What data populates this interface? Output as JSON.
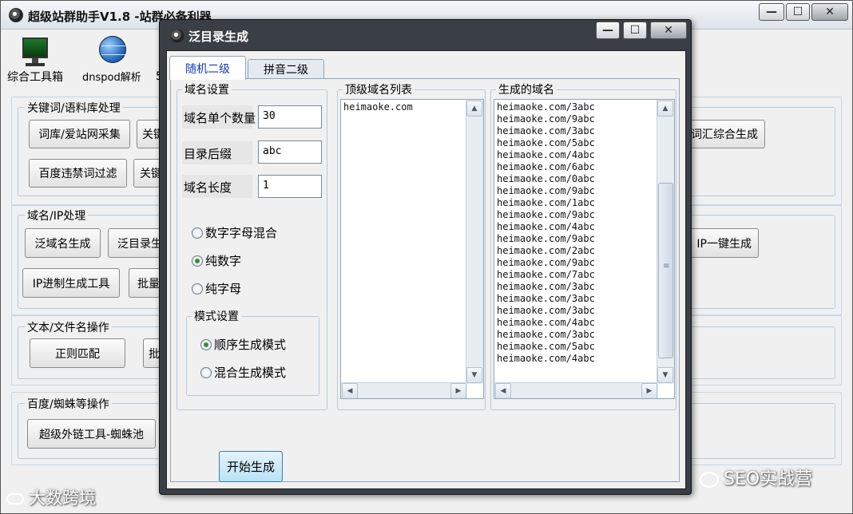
{
  "main_window": {
    "title": "超级站群助手V1.8 -站群必备利器",
    "toolbar": [
      {
        "label": "综合工具箱",
        "icon": "computer-monitor-icon"
      },
      {
        "label": "dnspod解析",
        "icon": "globe-network-icon"
      }
    ],
    "groups": {
      "keywords": {
        "title": "关键词/语料库处理",
        "buttons": [
          "词库/爱站网采集",
          "关键",
          "百度违禁词过滤",
          "关键",
          "词汇综合生成"
        ]
      },
      "domain_ip": {
        "title": "域名/IP处理",
        "buttons": [
          "泛域名生成",
          "泛目录生",
          "IP进制生成工具",
          "批量",
          "IP一键生成"
        ]
      },
      "text_file": {
        "title": "文本/文件名操作",
        "buttons": [
          "正则匹配",
          "批"
        ]
      },
      "baidu_spider": {
        "title": "百度/蜘蛛等操作",
        "buttons": [
          "超级外链工具-蜘蛛池"
        ]
      }
    },
    "partial_toolbar_char": "5"
  },
  "dialog": {
    "title": "泛目录生成",
    "tabs": [
      "随机二级",
      "拼音二级"
    ],
    "domain_settings": {
      "title": "域名设置",
      "count_label": "域名单个数量",
      "count_value": "30",
      "suffix_label": "目录后缀",
      "suffix_value": "abc",
      "length_label": "域名长度",
      "length_value": "1",
      "char_options": [
        {
          "label": "数字字母混合",
          "checked": false
        },
        {
          "label": "纯数字",
          "checked": true
        },
        {
          "label": "纯字母",
          "checked": false
        }
      ],
      "mode_title": "模式设置",
      "mode_options": [
        {
          "label": "顺序生成模式",
          "checked": true
        },
        {
          "label": "混合生成模式",
          "checked": false
        }
      ]
    },
    "top_domain_list": {
      "title": "顶级域名列表",
      "items": [
        "heimaoke.com"
      ]
    },
    "generated_list": {
      "title": "生成的域名",
      "items": [
        "heimaoke.com/3abc",
        "heimaoke.com/9abc",
        "heimaoke.com/3abc",
        "heimaoke.com/5abc",
        "heimaoke.com/4abc",
        "heimaoke.com/6abc",
        "heimaoke.com/0abc",
        "heimaoke.com/9abc",
        "heimaoke.com/1abc",
        "heimaoke.com/9abc",
        "heimaoke.com/4abc",
        "heimaoke.com/9abc",
        "heimaoke.com/2abc",
        "heimaoke.com/9abc",
        "heimaoke.com/7abc",
        "heimaoke.com/3abc",
        "heimaoke.com/3abc",
        "heimaoke.com/3abc",
        "heimaoke.com/4abc",
        "heimaoke.com/3abc",
        "heimaoke.com/5abc",
        "heimaoke.com/4abc"
      ]
    },
    "start_button": "开始生成"
  },
  "window_controls": {
    "minimize": "—",
    "maximize": "☐",
    "close": "✕"
  },
  "scroll_arrows": {
    "up": "▲",
    "down": "▼",
    "left": "◀",
    "right": "▶",
    "grip": "≡"
  },
  "watermarks": {
    "bottom_left": "大数跨境",
    "bottom_right": "SEO实战营"
  },
  "colors": {
    "dialog_frame": "#3a3f45",
    "active_tab_text": "#123ac0",
    "start_button_bg": "#b9e2f5",
    "radio_checked": "#3c8a3c"
  }
}
